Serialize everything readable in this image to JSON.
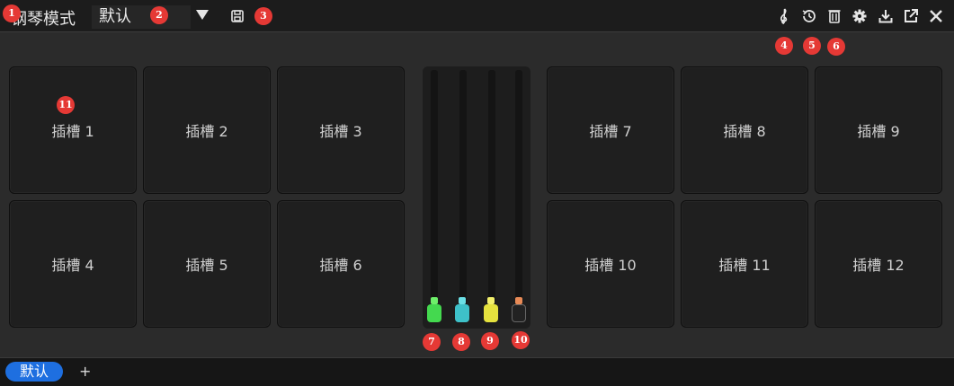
{
  "titlebar": {
    "title": "钢琴模式",
    "preset": "默认",
    "icons": [
      "save-icon",
      "treble-clef-icon",
      "history-icon",
      "trash-icon",
      "gear-icon",
      "download-icon",
      "external-link-icon",
      "close-icon"
    ]
  },
  "badges": [
    "1",
    "2",
    "3",
    "4",
    "5",
    "6",
    "7",
    "8",
    "9",
    "10",
    "11"
  ],
  "slots": {
    "s1": "插槽 1",
    "s2": "插槽 2",
    "s3": "插槽 3",
    "s4": "插槽 4",
    "s5": "插槽 5",
    "s6": "插槽 6",
    "s7": "插槽 7",
    "s8": "插槽 8",
    "s9": "插槽 9",
    "s10": "插槽 10",
    "s11": "插槽 11",
    "s12": "插槽 12"
  },
  "mixer": {
    "colors": [
      "#44d94f",
      "#3ec1c9",
      "#e5e23e",
      "#222222"
    ],
    "cap_colors": [
      "#6ef06a",
      "#6be0e6",
      "#f3f06c",
      "#e88a56"
    ],
    "levels": [
      0.0,
      0.0,
      0.0,
      0.0
    ]
  },
  "tabs": {
    "active": "默认",
    "add": "+"
  }
}
